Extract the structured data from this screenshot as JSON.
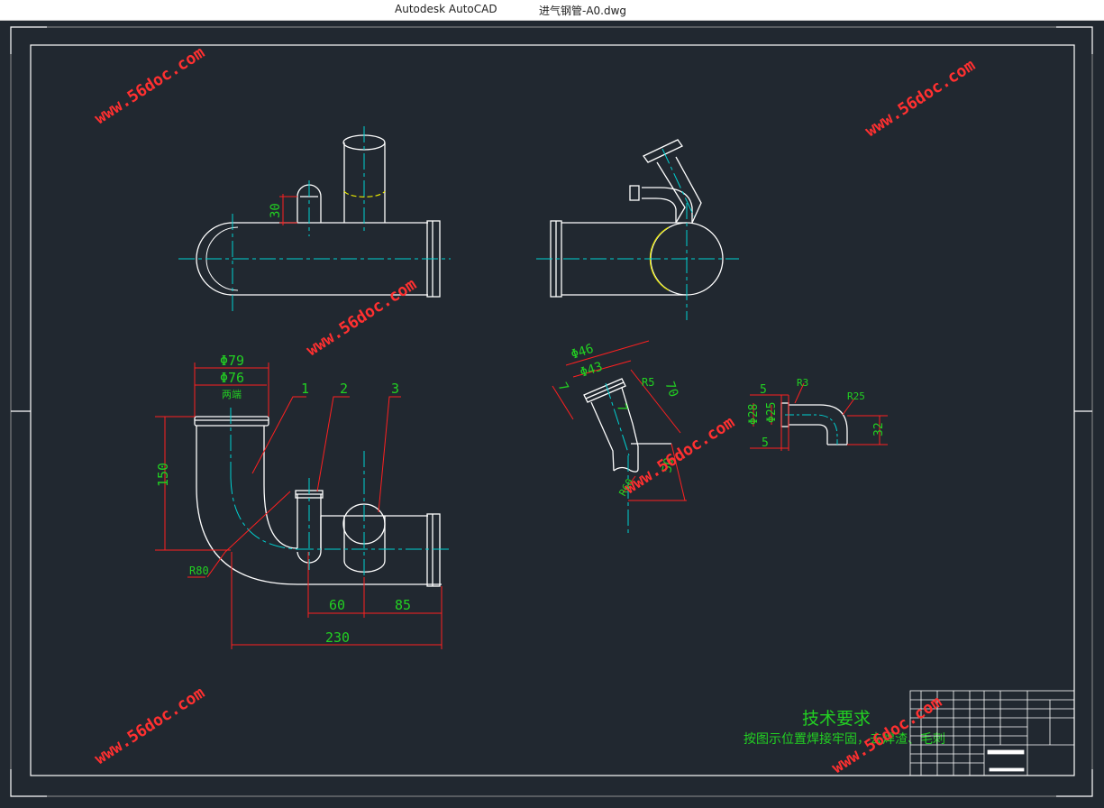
{
  "window": {
    "app_name": "Autodesk AutoCAD",
    "file_name": "进气钢管-A0.dwg"
  },
  "watermark": {
    "text": "www.56doc.com"
  },
  "drawing": {
    "dimensions": {
      "dim_30": "30",
      "dim_phi79": "Φ79",
      "dim_phi76": "Φ76",
      "both_ends": "两端",
      "dim_150": "150",
      "dim_r80": "R80",
      "dim_60": "60",
      "dim_85": "85",
      "dim_230": "230",
      "dim_phi46": "Φ46",
      "dim_phi43": "Φ43",
      "dim_7a": "7",
      "dim_7b": "7",
      "dim_r5": "R5",
      "dim_70": "70",
      "dim_50": "50",
      "dim_r60": "R60",
      "dim_5a": "5",
      "dim_5b": "5",
      "dim_r3": "R3",
      "dim_r25": "R25",
      "dim_phi28": "Φ28",
      "dim_phi25": "Φ25",
      "dim_32": "32"
    },
    "balloons": {
      "b1": "1",
      "b2": "2",
      "b3": "3"
    },
    "tech_requirements": {
      "title": "技术要求",
      "text": "按图示位置焊接牢固，去焊渣、毛刺"
    }
  },
  "colors": {
    "background": "#212830",
    "outline": "#ffffff",
    "centerline": "#00d2d2",
    "dimension": "#ff2020",
    "dim_text": "#22d022",
    "hidden_yellow": "#e6e600",
    "watermark": "#ff3030"
  }
}
